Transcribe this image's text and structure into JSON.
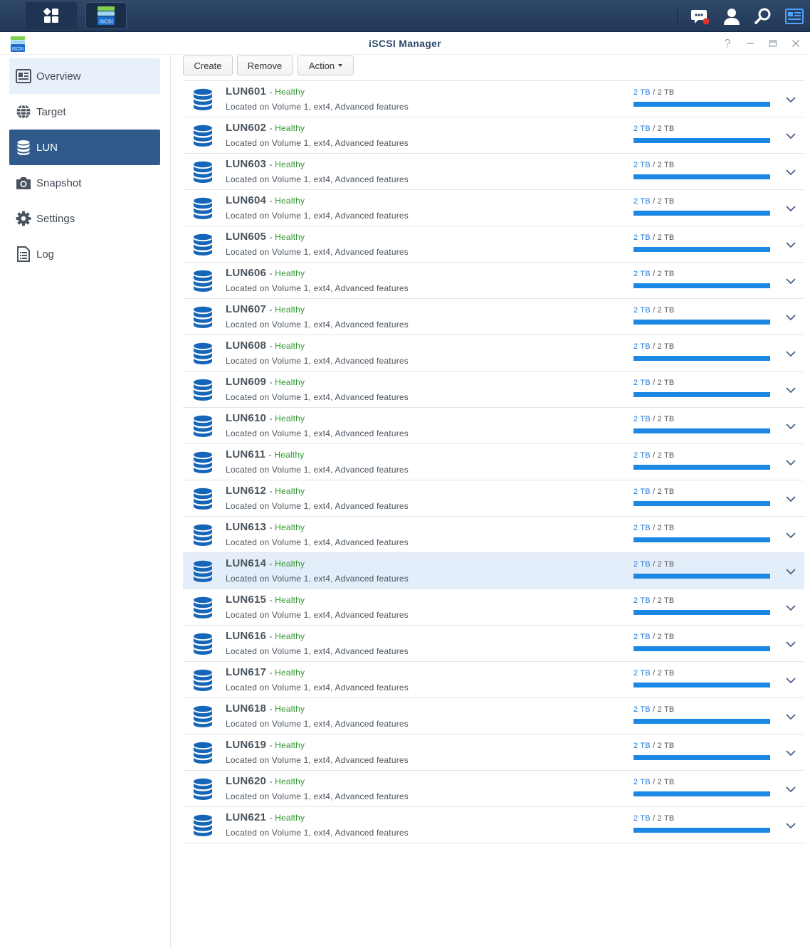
{
  "taskbar": {
    "main_menu_icon": "main-menu-icon",
    "app_badge_label": "iSCSI",
    "right_icons": [
      "notifications-icon",
      "user-icon",
      "search-icon",
      "widgets-icon"
    ]
  },
  "window": {
    "title": "iSCSI Manager",
    "app_icon_label": "iSCSI",
    "controls": [
      "help-icon",
      "minimize-icon",
      "maximize-icon",
      "close-icon"
    ]
  },
  "sidebar": {
    "items": [
      {
        "label": "Overview",
        "icon": "overview-icon",
        "state": "hover"
      },
      {
        "label": "Target",
        "icon": "globe-icon",
        "state": ""
      },
      {
        "label": "LUN",
        "icon": "database-icon",
        "state": "active"
      },
      {
        "label": "Snapshot",
        "icon": "camera-icon",
        "state": ""
      },
      {
        "label": "Settings",
        "icon": "gear-icon",
        "state": ""
      },
      {
        "label": "Log",
        "icon": "document-icon",
        "state": ""
      }
    ]
  },
  "toolbar": {
    "create_label": "Create",
    "remove_label": "Remove",
    "action_label": "Action"
  },
  "colors": {
    "accent": "#2f5a8b",
    "healthy": "#2f9a2f",
    "bar_fill": "#1b88e6",
    "selected_row": "#e4eefb"
  },
  "luns": [
    {
      "name": "LUN601",
      "status": "Healthy",
      "location": "Located on Volume 1, ext4, Advanced features",
      "used": "2 TB",
      "total": "2 TB",
      "usage_fraction": 1.0
    },
    {
      "name": "LUN602",
      "status": "Healthy",
      "location": "Located on Volume 1, ext4, Advanced features",
      "used": "2 TB",
      "total": "2 TB",
      "usage_fraction": 1.0
    },
    {
      "name": "LUN603",
      "status": "Healthy",
      "location": "Located on Volume 1, ext4, Advanced features",
      "used": "2 TB",
      "total": "2 TB",
      "usage_fraction": 1.0
    },
    {
      "name": "LUN604",
      "status": "Healthy",
      "location": "Located on Volume 1, ext4, Advanced features",
      "used": "2 TB",
      "total": "2 TB",
      "usage_fraction": 1.0
    },
    {
      "name": "LUN605",
      "status": "Healthy",
      "location": "Located on Volume 1, ext4, Advanced features",
      "used": "2 TB",
      "total": "2 TB",
      "usage_fraction": 1.0
    },
    {
      "name": "LUN606",
      "status": "Healthy",
      "location": "Located on Volume 1, ext4, Advanced features",
      "used": "2 TB",
      "total": "2 TB",
      "usage_fraction": 1.0
    },
    {
      "name": "LUN607",
      "status": "Healthy",
      "location": "Located on Volume 1, ext4, Advanced features",
      "used": "2 TB",
      "total": "2 TB",
      "usage_fraction": 1.0
    },
    {
      "name": "LUN608",
      "status": "Healthy",
      "location": "Located on Volume 1, ext4, Advanced features",
      "used": "2 TB",
      "total": "2 TB",
      "usage_fraction": 1.0
    },
    {
      "name": "LUN609",
      "status": "Healthy",
      "location": "Located on Volume 1, ext4, Advanced features",
      "used": "2 TB",
      "total": "2 TB",
      "usage_fraction": 1.0
    },
    {
      "name": "LUN610",
      "status": "Healthy",
      "location": "Located on Volume 1, ext4, Advanced features",
      "used": "2 TB",
      "total": "2 TB",
      "usage_fraction": 1.0
    },
    {
      "name": "LUN611",
      "status": "Healthy",
      "location": "Located on Volume 1, ext4, Advanced features",
      "used": "2 TB",
      "total": "2 TB",
      "usage_fraction": 1.0
    },
    {
      "name": "LUN612",
      "status": "Healthy",
      "location": "Located on Volume 1, ext4, Advanced features",
      "used": "2 TB",
      "total": "2 TB",
      "usage_fraction": 1.0
    },
    {
      "name": "LUN613",
      "status": "Healthy",
      "location": "Located on Volume 1, ext4, Advanced features",
      "used": "2 TB",
      "total": "2 TB",
      "usage_fraction": 1.0
    },
    {
      "name": "LUN614",
      "status": "Healthy",
      "location": "Located on Volume 1, ext4, Advanced features",
      "used": "2 TB",
      "total": "2 TB",
      "usage_fraction": 1.0,
      "selected": true
    },
    {
      "name": "LUN615",
      "status": "Healthy",
      "location": "Located on Volume 1, ext4, Advanced features",
      "used": "2 TB",
      "total": "2 TB",
      "usage_fraction": 1.0
    },
    {
      "name": "LUN616",
      "status": "Healthy",
      "location": "Located on Volume 1, ext4, Advanced features",
      "used": "2 TB",
      "total": "2 TB",
      "usage_fraction": 1.0
    },
    {
      "name": "LUN617",
      "status": "Healthy",
      "location": "Located on Volume 1, ext4, Advanced features",
      "used": "2 TB",
      "total": "2 TB",
      "usage_fraction": 1.0
    },
    {
      "name": "LUN618",
      "status": "Healthy",
      "location": "Located on Volume 1, ext4, Advanced features",
      "used": "2 TB",
      "total": "2 TB",
      "usage_fraction": 1.0
    },
    {
      "name": "LUN619",
      "status": "Healthy",
      "location": "Located on Volume 1, ext4, Advanced features",
      "used": "2 TB",
      "total": "2 TB",
      "usage_fraction": 1.0
    },
    {
      "name": "LUN620",
      "status": "Healthy",
      "location": "Located on Volume 1, ext4, Advanced features",
      "used": "2 TB",
      "total": "2 TB",
      "usage_fraction": 1.0
    },
    {
      "name": "LUN621",
      "status": "Healthy",
      "location": "Located on Volume 1, ext4, Advanced features",
      "used": "2 TB",
      "total": "2 TB",
      "usage_fraction": 1.0
    }
  ]
}
